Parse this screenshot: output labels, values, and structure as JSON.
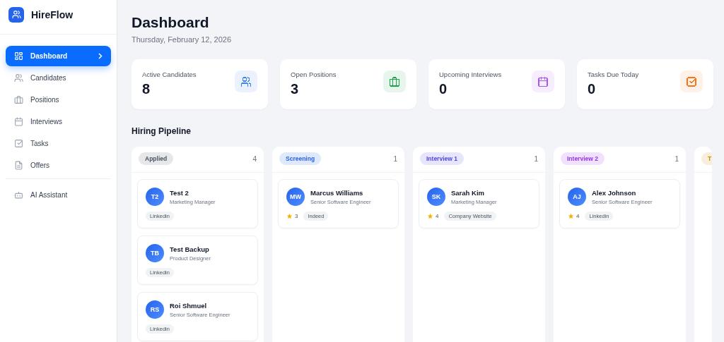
{
  "sidebar": {
    "brand": "HireFlow",
    "items": [
      {
        "label": "Dashboard",
        "selected": true
      },
      {
        "label": "Candidates",
        "selected": false
      },
      {
        "label": "Positions",
        "selected": false
      },
      {
        "label": "Interviews",
        "selected": false
      },
      {
        "label": "Tasks",
        "selected": false
      },
      {
        "label": "Offers",
        "selected": false
      }
    ],
    "footer_items": [
      {
        "label": "AI Assistant",
        "selected": false
      }
    ]
  },
  "header": {
    "title": "Dashboard",
    "date": "Thursday, February 12, 2026"
  },
  "stats": [
    {
      "label": "Active Candidates",
      "value": "8",
      "color": "#3b82f6"
    },
    {
      "label": "Open Positions",
      "value": "3",
      "color": "#16a34a"
    },
    {
      "label": "Upcoming Interviews",
      "value": "0",
      "color": "#a855f7"
    },
    {
      "label": "Tasks Due Today",
      "value": "0",
      "color": "#f97316"
    }
  ],
  "pipeline": {
    "title": "Hiring Pipeline",
    "columns": [
      {
        "label": "Applied",
        "count": "4",
        "color": "#4b5563",
        "cards": [
          {
            "initials": "T2",
            "name": "Test 2",
            "role": "Marketing Manager",
            "source": "Linkedin"
          },
          {
            "initials": "TB",
            "name": "Test Backup",
            "role": "Product Designer",
            "source": "Linkedin"
          },
          {
            "initials": "RS",
            "name": "Roi Shmuel",
            "role": "Senior Software Engineer",
            "source": "Linkedin"
          }
        ]
      },
      {
        "label": "Screening",
        "count": "1",
        "color": "#2563eb",
        "cards": [
          {
            "initials": "MW",
            "name": "Marcus Williams",
            "role": "Senior Software Engineer",
            "rating": "3",
            "source": "Indeed"
          }
        ]
      },
      {
        "label": "Interview 1",
        "count": "1",
        "color": "#4f46e5",
        "cards": [
          {
            "initials": "SK",
            "name": "Sarah Kim",
            "role": "Marketing Manager",
            "rating": "4",
            "source": "Company Website"
          }
        ]
      },
      {
        "label": "Interview 2",
        "count": "1",
        "color": "#9333ea",
        "cards": [
          {
            "initials": "AJ",
            "name": "Alex Johnson",
            "role": "Senior Software Engineer",
            "rating": "4",
            "source": "Linkedin"
          }
        ]
      },
      {
        "label": "T",
        "color": "#ca8a04"
      }
    ]
  }
}
